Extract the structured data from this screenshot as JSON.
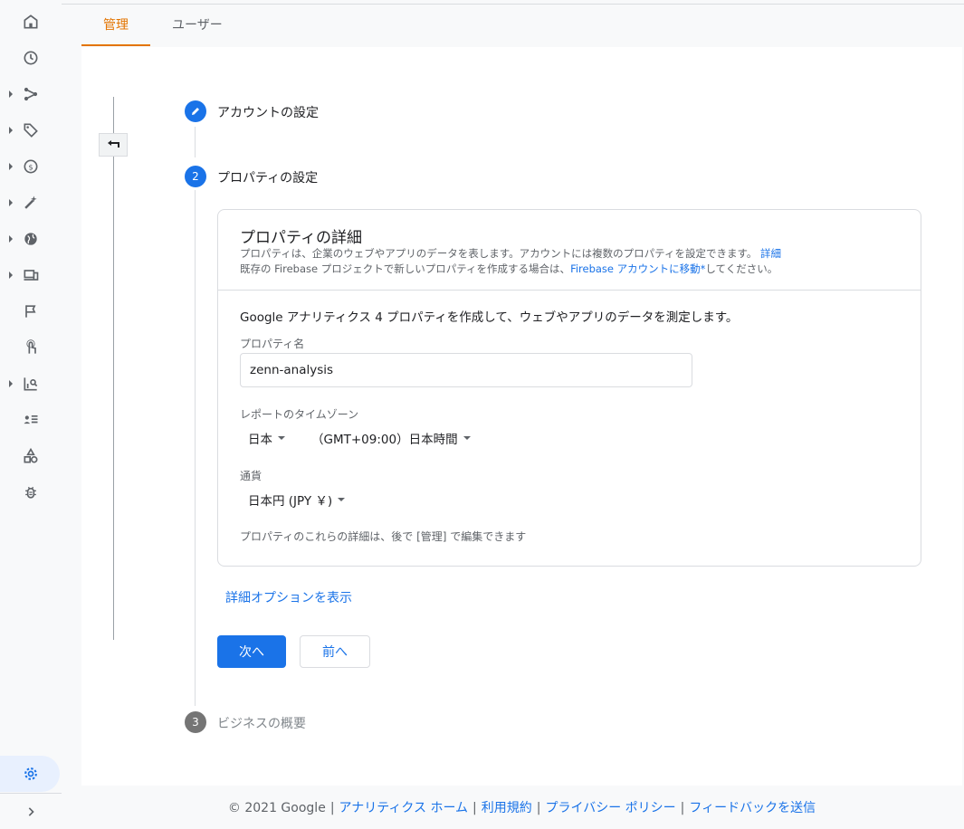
{
  "tabs": [
    {
      "label": "管理",
      "active": true
    },
    {
      "label": "ユーザー",
      "active": false
    }
  ],
  "rail": {
    "items": [
      {
        "icon": "home-icon"
      },
      {
        "icon": "clock-icon"
      },
      {
        "icon": "share-icon"
      },
      {
        "icon": "tag-icon"
      },
      {
        "icon": "dollar-icon"
      },
      {
        "icon": "magic-wand-icon"
      },
      {
        "icon": "globe-icon"
      },
      {
        "icon": "devices-icon"
      },
      {
        "icon": "flag-icon"
      },
      {
        "icon": "touch-icon"
      },
      {
        "icon": "report-search-icon"
      },
      {
        "icon": "audience-list-icon"
      },
      {
        "icon": "shapes-icon"
      },
      {
        "icon": "bug-icon"
      },
      {
        "icon": "gear-icon"
      },
      {
        "icon": "chevron-right-icon"
      }
    ]
  },
  "steps": [
    {
      "number": "",
      "title": "アカウントの設定",
      "state": "done"
    },
    {
      "number": "2",
      "title": "プロパティの設定",
      "state": "active"
    },
    {
      "number": "3",
      "title": "ビジネスの概要",
      "state": "pending"
    }
  ],
  "card": {
    "title": "プロパティの詳細",
    "desc1": "プロパティは、企業のウェブやアプリのデータを表します。アカウントには複数のプロパティを設定できます。",
    "desc1_link": "詳細",
    "desc2_pre": "既存の Firebase プロジェクトで新しいプロパティを作成する場合は、",
    "desc2_link": "Firebase アカウントに移動*",
    "desc2_post": "してください。",
    "intro": "Google アナリティクス 4 プロパティを作成して、ウェブやアプリのデータを測定します。",
    "property_name_label": "プロパティ名",
    "property_name_value": "zenn-analysis",
    "timezone_label": "レポートのタイムゾーン",
    "timezone_country": "日本",
    "timezone_value": "（GMT+09:00）日本時間",
    "currency_label": "通貨",
    "currency_value": "日本円 (JPY ￥)",
    "note": "プロパティのこれらの詳細は、後で [管理] で編集できます"
  },
  "advanced_link": "詳細オプションを表示",
  "buttons": {
    "next": "次へ",
    "prev": "前へ"
  },
  "footer": {
    "copyright": "© 2021 Google",
    "links": [
      "アナリティクス ホーム",
      "利用規約",
      "プライバシー ポリシー",
      "フィードバックを送信"
    ]
  },
  "colors": {
    "accent": "#1a73e8",
    "tab_active": "#e37400"
  }
}
